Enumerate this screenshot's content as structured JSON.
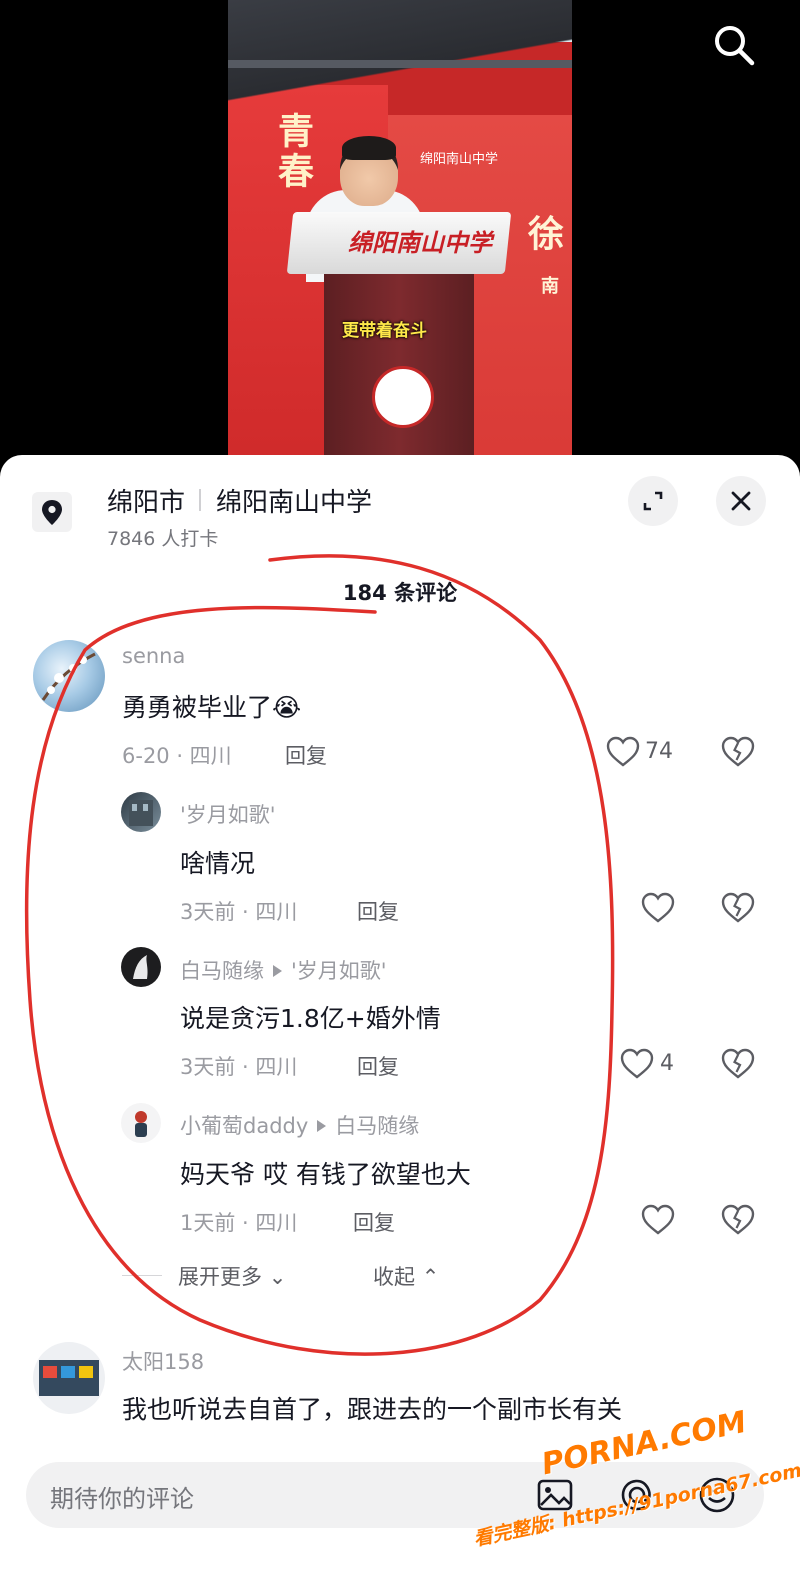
{
  "video": {
    "caption": "更带着奋斗",
    "banner_vertical": "青春",
    "banner_small": "绵阳南山中学",
    "banner_big": "徐",
    "banner_mid": "南",
    "podium_text": "绵阳南山中学",
    "search_icon": "search-icon"
  },
  "location": {
    "city": "绵阳市",
    "school": "绵阳南山中学",
    "checkins": "7846 人打卡",
    "icon": "location-pin-icon"
  },
  "comments_header": {
    "count_label": "184 条评论"
  },
  "comments": [
    {
      "user": "senna",
      "text": "勇勇被毕业了",
      "emoji": "😭",
      "meta": "6-20 · 四川",
      "reply_label": "回复",
      "likes": "74"
    },
    {
      "user": "'岁月如歌'",
      "text": "啥情况",
      "meta": "3天前 · 四川",
      "reply_label": "回复",
      "likes": ""
    },
    {
      "user": "白马随缘",
      "reply_to": "'岁月如歌'",
      "text": "说是贪污1.8亿+婚外情",
      "meta": "3天前 · 四川",
      "reply_label": "回复",
      "likes": "4"
    },
    {
      "user": "小葡萄daddy",
      "reply_to": "白马随缘",
      "text": "妈天爷  哎 有钱了欲望也大",
      "meta": "1天前 · 四川",
      "reply_label": "回复",
      "likes": ""
    },
    {
      "user": "太阳158",
      "text": "我也听说去自首了，跟进去的一个副市长有关"
    }
  ],
  "thread_controls": {
    "expand_more": "展开更多",
    "collapse": "收起"
  },
  "input_bar": {
    "placeholder": "期待你的评论",
    "icons": [
      "image-icon",
      "at-icon",
      "emoji-icon"
    ]
  },
  "watermark": {
    "brand": "PORNA.COM",
    "text": "看完整版: https://91porna67.com"
  },
  "colors": {
    "annotation_red": "#e0302b",
    "watermark_orange": "#ff7a00",
    "text_primary": "#161823",
    "text_secondary": "#9a9ba1"
  }
}
